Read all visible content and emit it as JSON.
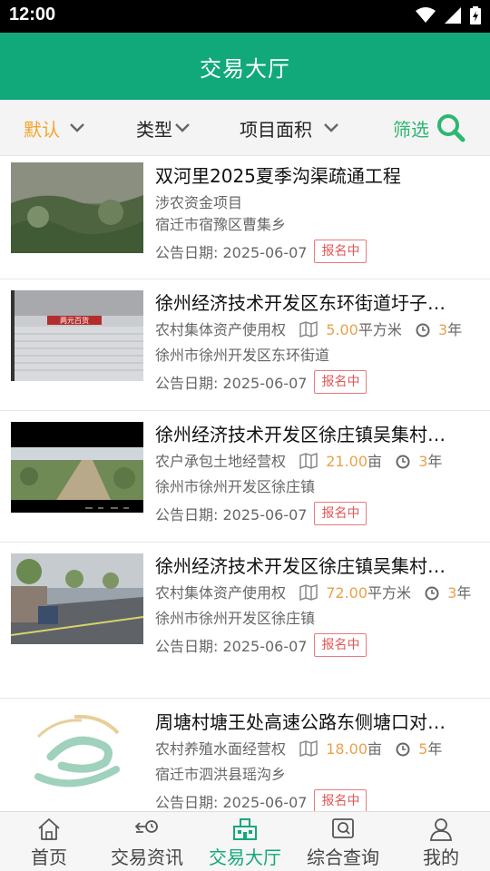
{
  "status": {
    "time": "12:00"
  },
  "header": {
    "title": "交易大厅"
  },
  "filters": {
    "default": "默认",
    "type": "类型",
    "area": "项目面积",
    "screen": "筛选"
  },
  "items": [
    {
      "title": "双河里2025夏季沟渠疏通工程",
      "category": "涉农资金项目",
      "location": "宿迁市宿豫区曹集乡",
      "date_label": "公告日期: 2025-06-07",
      "status": "报名中"
    },
    {
      "title": "徐州经济技术开发区东环街道圩子…",
      "category": "农村集体资产使用权",
      "area_value": "5.00",
      "area_unit": "平方米",
      "years_value": "3",
      "years_unit": "年",
      "location": "徐州市徐州开发区东环街道",
      "date_label": "公告日期: 2025-06-07",
      "status": "报名中",
      "image_text": "两元百货"
    },
    {
      "title": "徐州经济技术开发区徐庄镇吴集村…",
      "category": "农户承包土地经营权",
      "area_value": "21.00",
      "area_unit": "亩",
      "years_value": "3",
      "years_unit": "年",
      "location": "徐州市徐州开发区徐庄镇",
      "date_label": "公告日期: 2025-06-07",
      "status": "报名中"
    },
    {
      "title": "徐州经济技术开发区徐庄镇吴集村…",
      "category": "农村集体资产使用权",
      "area_value": "72.00",
      "area_unit": "平方米",
      "years_value": "3",
      "years_unit": "年",
      "location": "徐州市徐州开发区徐庄镇",
      "date_label": "公告日期: 2025-06-07",
      "status": "报名中"
    },
    {
      "title": "周塘村塘王处高速公路东侧塘口对…",
      "category": "农村养殖水面经营权",
      "area_value": "18.00",
      "area_unit": "亩",
      "years_value": "5",
      "years_unit": "年",
      "location": "宿迁市泗洪县瑶沟乡",
      "date_label": "公告日期: 2025-06-07",
      "status": "报名中"
    }
  ],
  "tabs": [
    {
      "label": "首页",
      "icon": "home-icon"
    },
    {
      "label": "交易资讯",
      "icon": "news-icon"
    },
    {
      "label": "交易大厅",
      "icon": "hall-icon"
    },
    {
      "label": "综合查询",
      "icon": "query-icon"
    },
    {
      "label": "我的",
      "icon": "user-icon"
    }
  ],
  "colors": {
    "primary": "#12a97a",
    "accent_orange": "#f2a52b",
    "badge_red": "#e25555",
    "filter_green": "#2eb672"
  }
}
